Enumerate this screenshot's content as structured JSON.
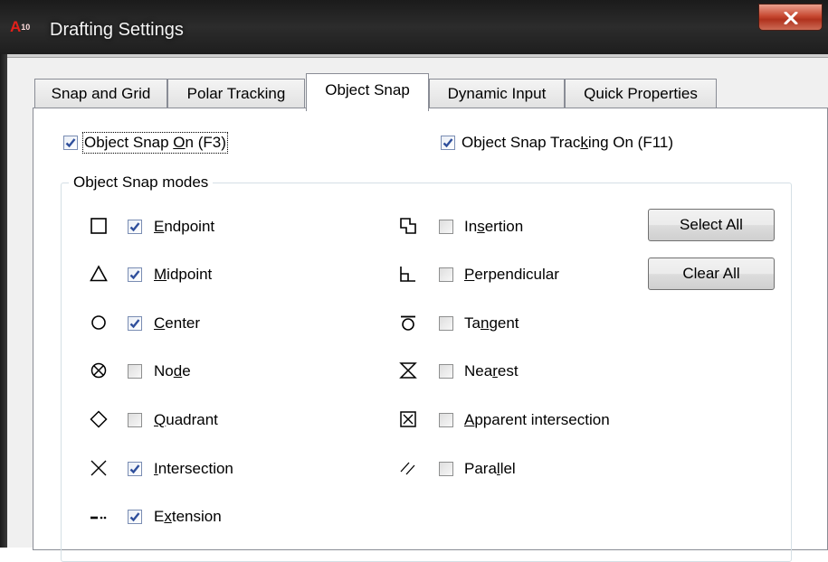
{
  "window": {
    "app_icon_text": "A",
    "app_icon_sub": "10",
    "title": "Drafting Settings"
  },
  "tabs": [
    {
      "label": "Snap and Grid"
    },
    {
      "label": "Polar Tracking"
    },
    {
      "label": "Object Snap"
    },
    {
      "label": "Dynamic Input"
    },
    {
      "label": "Quick Properties"
    }
  ],
  "active_tab": "Object Snap",
  "options": {
    "osnap_on": {
      "label_pre": "Object Snap ",
      "label_key": "O",
      "label_post": "n (F3)",
      "checked": true
    },
    "osnap_tracking": {
      "label_pre": "Object Snap Trac",
      "label_key": "k",
      "label_post": "ing On (F11)",
      "checked": true
    }
  },
  "group_title": "Object Snap modes",
  "modes_left": [
    {
      "pre": "",
      "key": "E",
      "post": "ndpoint",
      "checked": true,
      "icon": "square-icon"
    },
    {
      "pre": "",
      "key": "M",
      "post": "idpoint",
      "checked": true,
      "icon": "triangle-icon"
    },
    {
      "pre": "",
      "key": "C",
      "post": "enter",
      "checked": true,
      "icon": "circle-icon"
    },
    {
      "pre": "No",
      "key": "d",
      "post": "e",
      "checked": false,
      "icon": "node-icon"
    },
    {
      "pre": "",
      "key": "Q",
      "post": "uadrant",
      "checked": false,
      "icon": "diamond-icon"
    },
    {
      "pre": "",
      "key": "I",
      "post": "ntersection",
      "checked": true,
      "icon": "x-icon"
    },
    {
      "pre": "E",
      "key": "x",
      "post": "tension",
      "checked": true,
      "icon": "extension-icon"
    }
  ],
  "modes_right": [
    {
      "pre": "In",
      "key": "s",
      "post": "ertion",
      "checked": false,
      "icon": "insertion-icon"
    },
    {
      "pre": "",
      "key": "P",
      "post": "erpendicular",
      "checked": false,
      "icon": "perpendicular-icon"
    },
    {
      "pre": "Ta",
      "key": "n",
      "post": "gent",
      "checked": false,
      "icon": "tangent-icon"
    },
    {
      "pre": "Nea",
      "key": "r",
      "post": "est",
      "checked": false,
      "icon": "nearest-icon"
    },
    {
      "pre": "",
      "key": "A",
      "post": "pparent intersection",
      "checked": false,
      "icon": "apparent-intersection-icon"
    },
    {
      "pre": "Para",
      "key": "l",
      "post": "lel",
      "checked": false,
      "icon": "parallel-icon"
    }
  ],
  "buttons": {
    "select_all": "Select All",
    "clear_all": "Clear All"
  }
}
